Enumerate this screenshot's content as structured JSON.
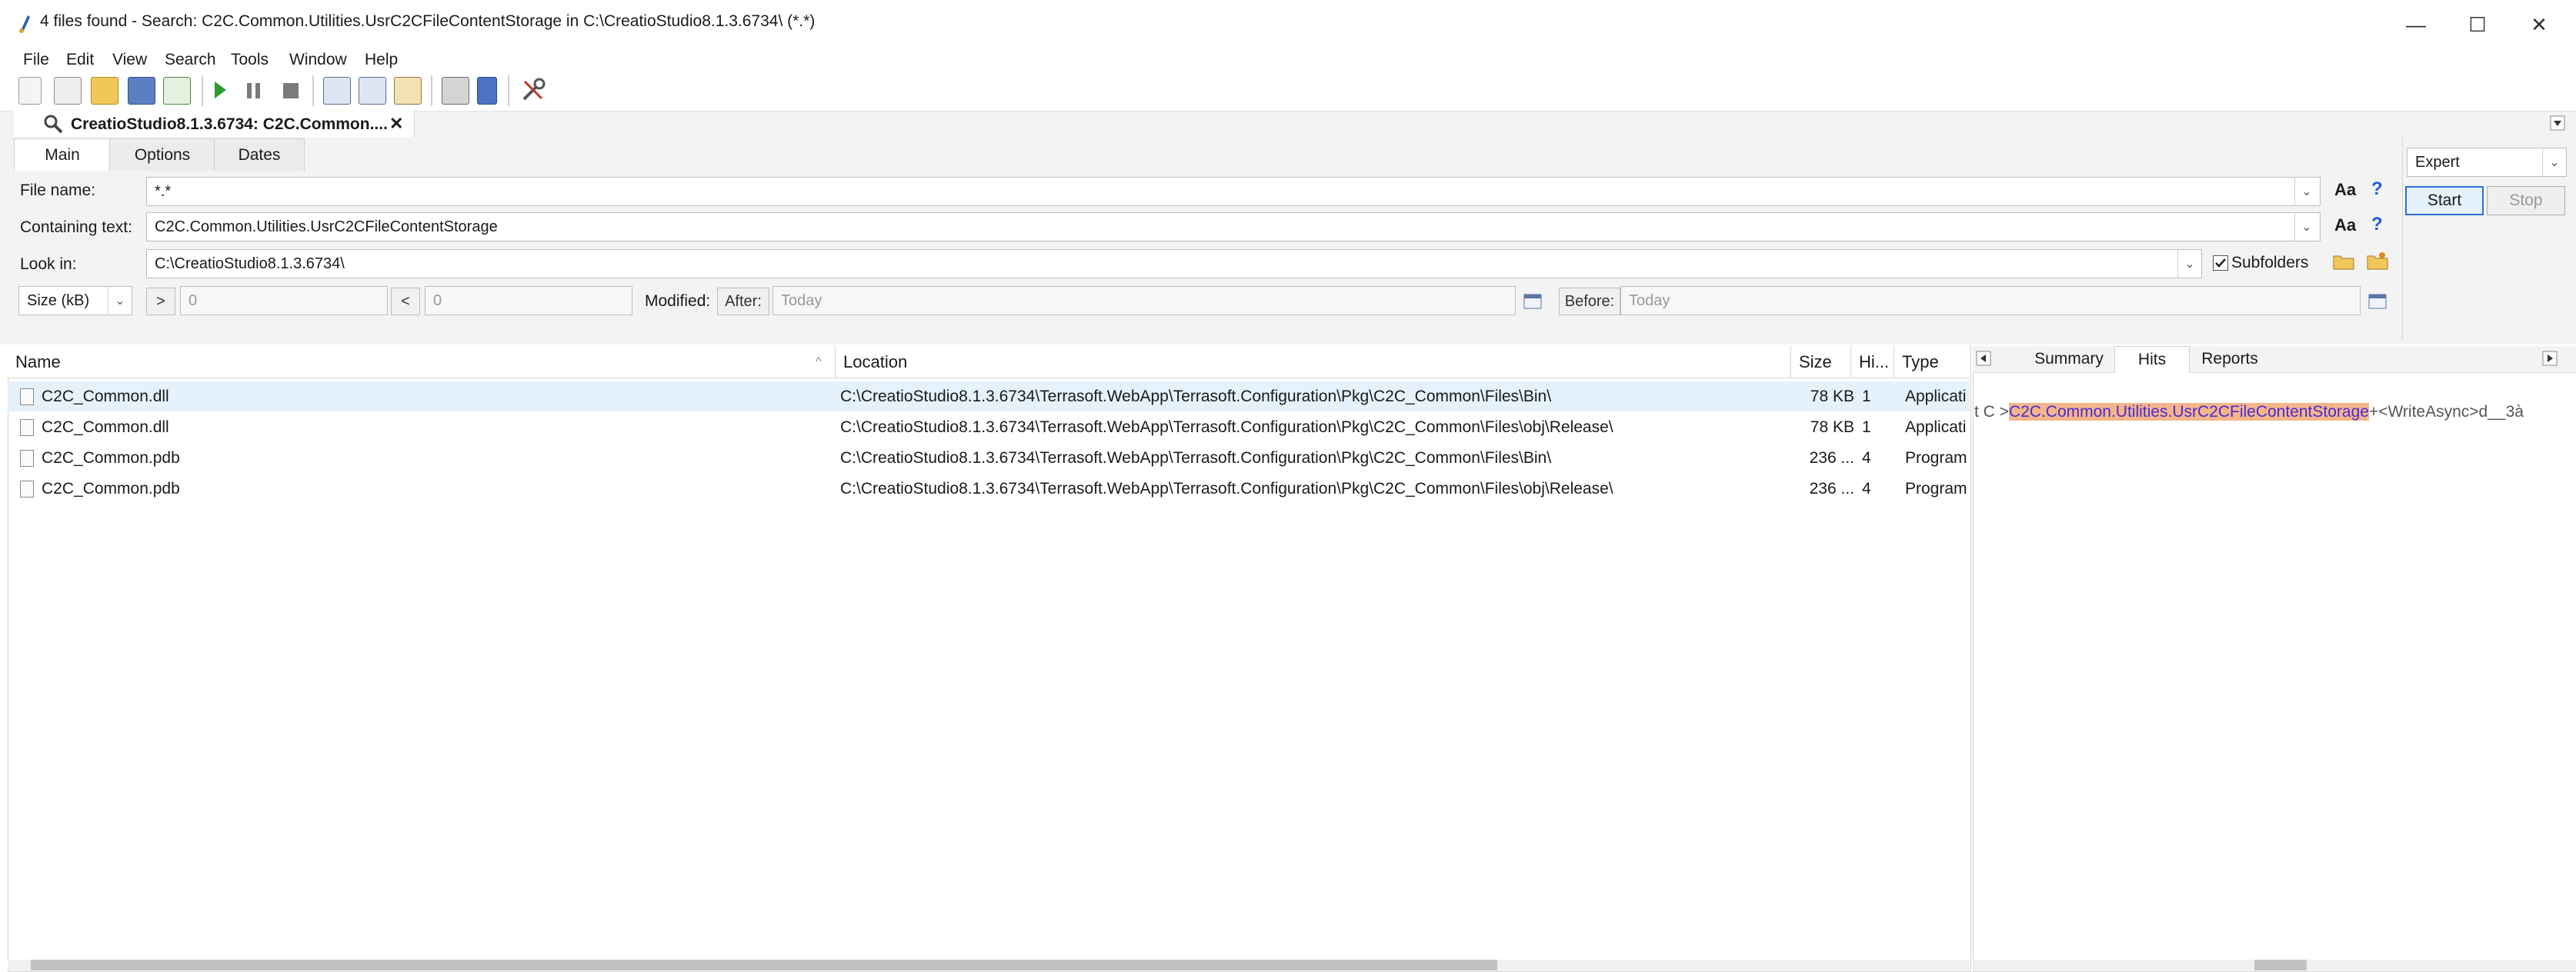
{
  "window": {
    "title": "4 files found - Search: C2C.Common.Utilities.UsrC2CFileContentStorage in C:\\CreatioStudio8.1.3.6734\\ (*.*)",
    "min_glyph": "—",
    "max_glyph": "☐",
    "close_glyph": "✕"
  },
  "menu": [
    "File",
    "Edit",
    "View",
    "Search",
    "Tools",
    "Window",
    "Help"
  ],
  "doc_tab": {
    "label": "CreatioStudio8.1.3.6734: C2C.Common....",
    "close_glyph": "✕"
  },
  "tabs": [
    "Main",
    "Options",
    "Dates"
  ],
  "form": {
    "file_name_label": "File name:",
    "file_name_value": "*.*",
    "containing_label": "Containing text:",
    "containing_value": "C2C.Common.Utilities.UsrC2CFileContentStorage",
    "look_in_label": "Look in:",
    "look_in_value": "C:\\CreatioStudio8.1.3.6734\\",
    "subfolders_label": "Subfolders",
    "size_unit": "Size (kB)",
    "gt_label": ">",
    "gt_value": "0",
    "lt_label": "<",
    "lt_value": "0",
    "modified_label": "Modified:",
    "after_label": "After:",
    "after_value": "Today",
    "before_label": "Before:",
    "before_value": "Today",
    "aa_glyph": "Aa",
    "help_glyph": "?",
    "dropdown_glyph": "⌄"
  },
  "right": {
    "mode": "Expert",
    "start_label": "Start",
    "stop_label": "Stop"
  },
  "results": {
    "headers": [
      "Name",
      "Location",
      "Size",
      "Hi...",
      "Type"
    ],
    "sort_glyph": "^",
    "rows": [
      {
        "name": "C2C_Common.dll",
        "location": "C:\\CreatioStudio8.1.3.6734\\Terrasoft.WebApp\\Terrasoft.Configuration\\Pkg\\C2C_Common\\Files\\Bin\\",
        "size": "78 KB",
        "hits": "1",
        "type": "Applicati"
      },
      {
        "name": "C2C_Common.dll",
        "location": "C:\\CreatioStudio8.1.3.6734\\Terrasoft.WebApp\\Terrasoft.Configuration\\Pkg\\C2C_Common\\Files\\obj\\Release\\",
        "size": "78 KB",
        "hits": "1",
        "type": "Applicati"
      },
      {
        "name": "C2C_Common.pdb",
        "location": "C:\\CreatioStudio8.1.3.6734\\Terrasoft.WebApp\\Terrasoft.Configuration\\Pkg\\C2C_Common\\Files\\Bin\\",
        "size": "236 ...",
        "hits": "4",
        "type": "Program"
      },
      {
        "name": "C2C_Common.pdb",
        "location": "C:\\CreatioStudio8.1.3.6734\\Terrasoft.WebApp\\Terrasoft.Configuration\\Pkg\\C2C_Common\\Files\\obj\\Release\\",
        "size": "236 ...",
        "hits": "4",
        "type": "Program"
      }
    ]
  },
  "preview": {
    "tabs": [
      "Summary",
      "Hits",
      "Reports"
    ],
    "prefix": "t C >",
    "match": "C2C.Common.Utilities.UsrC2CFileContentStorage",
    "suffix": "+<WriteAsync>d__3à"
  },
  "colors": {
    "accent": "#2a6fd6",
    "highlight": "#f5b58a",
    "selection": "#e5f1fb"
  }
}
